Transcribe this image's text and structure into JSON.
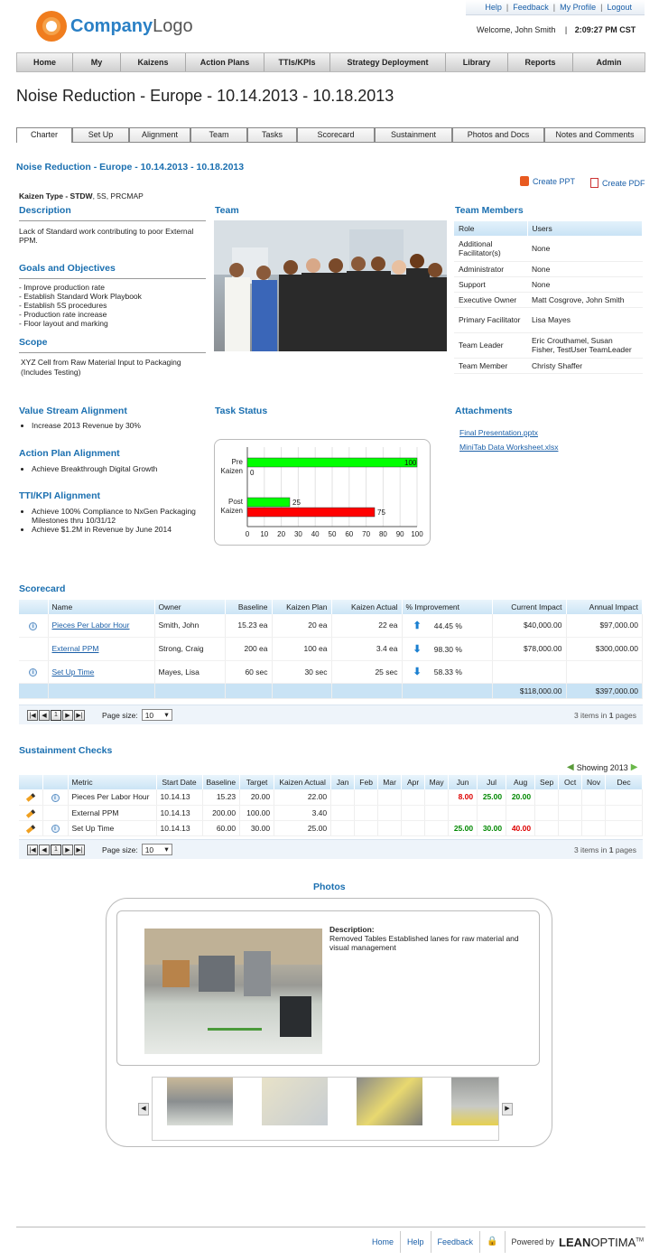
{
  "topbar": {
    "help": "Help",
    "feedback": "Feedback",
    "profile": "My Profile",
    "logout": "Logout"
  },
  "logo": {
    "part1": "Company",
    "part2": "Logo"
  },
  "welcome": {
    "text": "Welcome, John Smith",
    "sep": "|",
    "time": "2:09:27 PM CST"
  },
  "nav": [
    "Home",
    "My",
    "Kaizens",
    "Action Plans",
    "TTIs/KPIs",
    "Strategy Deployment",
    "Library",
    "Reports",
    "Admin"
  ],
  "page_title": "Noise Reduction - Europe - 10.14.2013 - 10.18.2013",
  "tabs": [
    "Charter",
    "Set Up",
    "Alignment",
    "Team",
    "Tasks",
    "Scorecard",
    "Sustainment",
    "Photos and Docs",
    "Notes and Comments"
  ],
  "charter": {
    "subtitle": "Noise Reduction - Europe - 10.14.2013 - 10.18.2013",
    "create_ppt": "Create PPT",
    "create_pdf": "Create PDF",
    "kaizen_type_label": "Kaizen Type -",
    "kaizen_type_value": "STDW",
    "kaizen_type_rest": ", 5S, PRCMAP",
    "description_title": "Description",
    "description": "Lack of Standard work contributing to poor External PPM.",
    "goals_title": "Goals and Objectives",
    "goals": [
      "- Improve production rate",
      "- Establish Standard Work Playbook",
      "- Establish 5S procedures",
      "- Production rate increase",
      "- Floor layout and marking"
    ],
    "scope_title": "Scope",
    "scope": "XYZ Cell from Raw Material Input to Packaging (Includes Testing)",
    "team_title": "Team",
    "team_members_title": "Team Members",
    "team_members_headers": [
      "Role",
      "Users"
    ],
    "team_members": [
      [
        "Additional Facilitator(s)",
        "None"
      ],
      [
        "Administrator",
        "None"
      ],
      [
        "Support",
        "None"
      ],
      [
        "Executive Owner",
        "Matt Cosgrove, John Smith"
      ],
      [
        "Primary Facilitator",
        "Lisa Mayes"
      ],
      [
        "Team Leader",
        "Eric Crouthamel, Susan Fisher, TestUser TeamLeader"
      ],
      [
        "Team Member",
        "Christy Shaffer"
      ]
    ],
    "vsa_title": "Value Stream Alignment",
    "vsa": [
      "Increase 2013 Revenue by 30%"
    ],
    "apa_title": "Action Plan Alignment",
    "apa": [
      "Achieve Breakthrough Digital Growth"
    ],
    "tti_title": "TTI/KPI Alignment",
    "tti": [
      "Achieve 100% Compliance to NxGen Packaging Milestones thru 10/31/12",
      "Achieve $1.2M in Revenue by June 2014"
    ],
    "task_status_title": "Task Status",
    "attachments_title": "Attachments",
    "attachments": [
      "Final Presentation.pptx",
      "MiniTab Data Worksheet.xlsx"
    ]
  },
  "chart_data": {
    "type": "bar",
    "orientation": "horizontal",
    "categories": [
      "Pre Kaizen",
      "Post Kaizen"
    ],
    "series": [
      {
        "color": "#00ff00",
        "values": [
          100,
          25
        ]
      },
      {
        "color": "#ff0000",
        "values": [
          0,
          75
        ]
      }
    ],
    "xlim": [
      0,
      100
    ],
    "xticks": [
      0,
      10,
      20,
      30,
      40,
      50,
      60,
      70,
      80,
      90,
      100
    ],
    "grid": true
  },
  "scorecard": {
    "title": "Scorecard",
    "headers": [
      "Name",
      "Owner",
      "Baseline",
      "Kaizen Plan",
      "Kaizen Actual",
      "% Improvement",
      "Current Impact",
      "Annual Impact"
    ],
    "rows": [
      {
        "name": "Pieces Per Labor Hour",
        "owner": "Smith, John",
        "baseline": "15.23 ea",
        "plan": "20 ea",
        "actual": "22 ea",
        "arrow": "⬆",
        "improvement": "44.45 %",
        "current": "$40,000.00",
        "annual": "$97,000.00",
        "info": true
      },
      {
        "name": "External PPM",
        "owner": "Strong, Craig",
        "baseline": "200 ea",
        "plan": "100 ea",
        "actual": "3.4 ea",
        "arrow": "⬇",
        "improvement": "98.30 %",
        "current": "$78,000.00",
        "annual": "$300,000.00",
        "info": false
      },
      {
        "name": "Set Up Time",
        "owner": "Mayes, Lisa",
        "baseline": "60 sec",
        "plan": "30 sec",
        "actual": "25 sec",
        "arrow": "⬇",
        "improvement": "58.33 %",
        "current": "",
        "annual": "",
        "info": true
      }
    ],
    "total_current": "$118,000.00",
    "total_annual": "$397,000.00",
    "page_size_label": "Page size:",
    "page_size": "10",
    "page": "1",
    "items_text": "3 items in",
    "pages_count": "1",
    "pages_word": "pages"
  },
  "sustainment": {
    "title": "Sustainment Checks",
    "showing": "Showing 2013",
    "headers": [
      "Metric",
      "Start Date",
      "Baseline",
      "Target",
      "Kaizen Actual",
      "Jan",
      "Feb",
      "Mar",
      "Apr",
      "May",
      "Jun",
      "Jul",
      "Aug",
      "Sep",
      "Oct",
      "Nov",
      "Dec"
    ],
    "rows": [
      {
        "metric": "Pieces Per Labor Hour",
        "start": "10.14.13",
        "baseline": "15.23",
        "target": "20.00",
        "actual": "22.00",
        "jun": "8.00",
        "jun_c": "red",
        "jul": "25.00",
        "jul_c": "green",
        "aug": "20.00",
        "aug_c": "green",
        "info": true
      },
      {
        "metric": "External PPM",
        "start": "10.14.13",
        "baseline": "200.00",
        "target": "100.00",
        "actual": "3.40",
        "jun": "",
        "jun_c": "",
        "jul": "",
        "jul_c": "",
        "aug": "",
        "aug_c": "",
        "info": false
      },
      {
        "metric": "Set Up Time",
        "start": "10.14.13",
        "baseline": "60.00",
        "target": "30.00",
        "actual": "25.00",
        "jun": "25.00",
        "jun_c": "green",
        "jul": "30.00",
        "jul_c": "green",
        "aug": "40.00",
        "aug_c": "red",
        "info": true
      }
    ],
    "page_size_label": "Page size:",
    "page_size": "10",
    "page": "1",
    "items_text": "3 items in",
    "pages_count": "1",
    "pages_word": "pages"
  },
  "photos": {
    "title": "Photos",
    "desc_label": "Description:",
    "desc": "Removed Tables Established lanes for raw material and visual management"
  },
  "footer": {
    "home": "Home",
    "help": "Help",
    "feedback": "Feedback",
    "powered": "Powered by",
    "brand1": "LEAN",
    "brand2": "OPTIMA",
    "tm": "TM"
  }
}
